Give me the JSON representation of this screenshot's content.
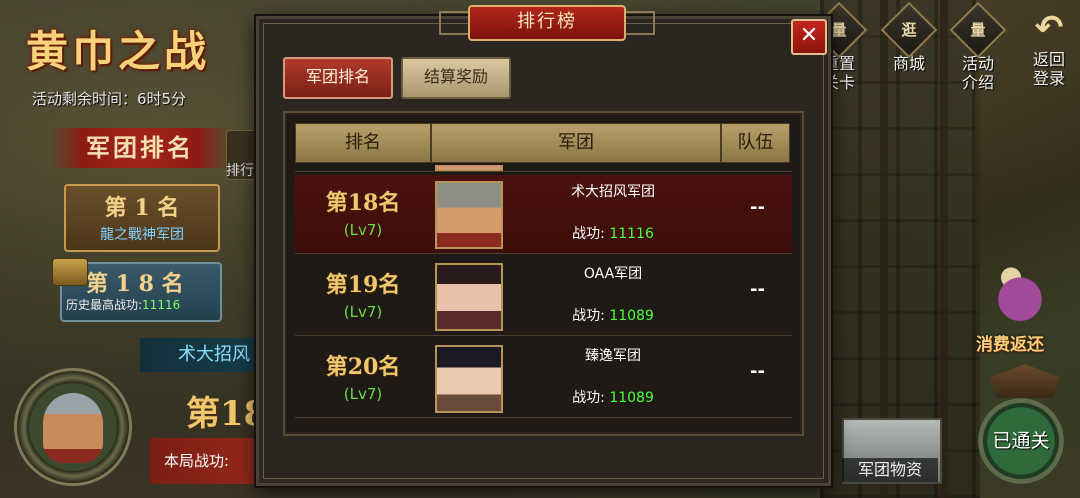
{
  "event": {
    "title": "黄巾之战",
    "time_remaining": "活动剩余时间：6时5分",
    "ranking_label": "军团排名",
    "side_button_label": "排行",
    "first_place": {
      "rank": "第 1 名",
      "name": "龍之戰神军团"
    },
    "my_rank": {
      "rank": "第 1 8 名",
      "history_label": "历史最高战功:",
      "history_value": "11116"
    },
    "my_legion_name": "术大招风",
    "rank_partial": "第18",
    "battle_label": "本局战功:"
  },
  "right_menu": {
    "items": [
      {
        "icon": "reset-stage-icon",
        "glyph": "量",
        "label": "重置\n关卡"
      },
      {
        "icon": "shop-icon",
        "glyph": "逛",
        "label": "商城"
      },
      {
        "icon": "activity-intro-icon",
        "glyph": "量",
        "label": "活动\n介绍"
      },
      {
        "icon": "back-arrow-icon",
        "glyph": "↶",
        "label": "返回\n登录"
      }
    ],
    "consume_rebate": "消费返还",
    "cleared_button": "已通关",
    "legion_supplies": "军团物资"
  },
  "modal": {
    "title": "排行榜",
    "close_glyph": "✕",
    "tabs": [
      {
        "label": "军团排名",
        "active": true
      },
      {
        "label": "结算奖励",
        "active": false
      }
    ],
    "columns": [
      "排名",
      "军团",
      "队伍"
    ],
    "rows": [
      {
        "rank": "第18名",
        "level": "(Lv7)",
        "legion": "术大招风军团",
        "battle_label": "战功:",
        "battle_value": "11116",
        "team": "--",
        "highlight": true
      },
      {
        "rank": "第19名",
        "level": "(Lv7)",
        "legion": "OAA军团",
        "battle_label": "战功:",
        "battle_value": "11089",
        "team": "--",
        "highlight": false
      },
      {
        "rank": "第20名",
        "level": "(Lv7)",
        "legion": "臻逸军团",
        "battle_label": "战功:",
        "battle_value": "11089",
        "team": "--",
        "highlight": false
      }
    ]
  },
  "colors": {
    "accent_red": "#b03a2c",
    "gold": "#f1c76d",
    "level_green": "#66dd44",
    "battle_green": "#4cff3a"
  }
}
